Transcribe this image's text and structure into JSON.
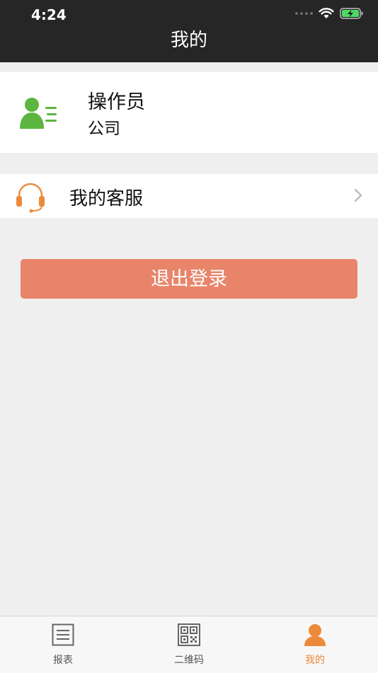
{
  "status_bar": {
    "time": "4:24"
  },
  "header": {
    "title": "我的"
  },
  "profile": {
    "name": "操作员",
    "company": "公司"
  },
  "service": {
    "label": "我的客服"
  },
  "logout": {
    "label": "退出登录"
  },
  "tabs": [
    {
      "label": "报表",
      "icon": "report-list-icon",
      "active": false
    },
    {
      "label": "二维码",
      "icon": "qr-code-icon",
      "active": false
    },
    {
      "label": "我的",
      "icon": "person-icon",
      "active": true
    }
  ],
  "colors": {
    "accent": "#ec8a3a",
    "logout_button": "#e8846a",
    "avatar_green": "#5cb53f",
    "header_bg": "#262626",
    "page_bg": "#efefef"
  }
}
